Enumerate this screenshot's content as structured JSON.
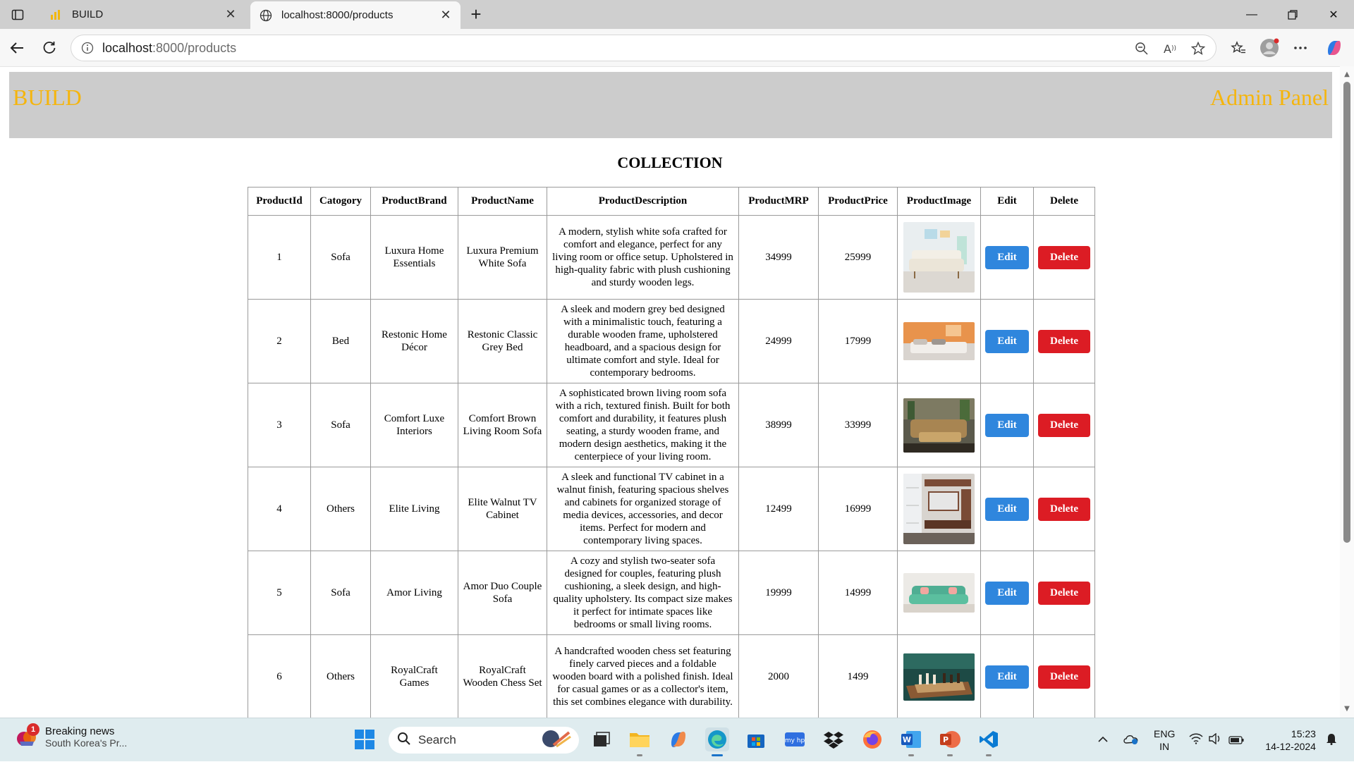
{
  "browser": {
    "tabs": [
      {
        "title": "BUILD",
        "active": false
      },
      {
        "title": "localhost:8000/products",
        "active": true
      }
    ],
    "url_host": "localhost",
    "url_path": ":8000/products"
  },
  "site": {
    "brand": "BUILD",
    "admin_label": "Admin Panel"
  },
  "page": {
    "title": "COLLECTION"
  },
  "table": {
    "headers": [
      "ProductId",
      "Catogory",
      "ProductBrand",
      "ProductName",
      "ProductDescription",
      "ProductMRP",
      "ProductPrice",
      "ProductImage",
      "Edit",
      "Delete"
    ],
    "rows": [
      {
        "id": "1",
        "category": "Sofa",
        "brand": "Luxura Home Essentials",
        "name": "Luxura Premium White Sofa",
        "description": "A modern, stylish white sofa crafted for comfort and elegance, perfect for any living room or office setup. Upholstered in high-quality fabric with plush cushioning and sturdy wooden legs.",
        "mrp": "34999",
        "price": "25999",
        "image": "white-sofa-image",
        "edit": "Edit",
        "delete": "Delete"
      },
      {
        "id": "2",
        "category": "Bed",
        "brand": "Restonic Home Décor",
        "name": "Restonic Classic Grey Bed",
        "description": "A sleek and modern grey bed designed with a minimalistic touch, featuring a durable wooden frame, upholstered headboard, and a spacious design for ultimate comfort and style. Ideal for contemporary bedrooms.",
        "mrp": "24999",
        "price": "17999",
        "image": "grey-bed-image",
        "edit": "Edit",
        "delete": "Delete"
      },
      {
        "id": "3",
        "category": "Sofa",
        "brand": "Comfort Luxe Interiors",
        "name": "Comfort Brown Living Room Sofa",
        "description": "A sophisticated brown living room sofa with a rich, textured finish. Built for both comfort and durability, it features plush seating, a sturdy wooden frame, and modern design aesthetics, making it the centerpiece of your living room.",
        "mrp": "38999",
        "price": "33999",
        "image": "brown-sofa-image",
        "edit": "Edit",
        "delete": "Delete"
      },
      {
        "id": "4",
        "category": "Others",
        "brand": "Elite Living",
        "name": "Elite Walnut TV Cabinet",
        "description": "A sleek and functional TV cabinet in a walnut finish, featuring spacious shelves and cabinets for organized storage of media devices, accessories, and decor items. Perfect for modern and contemporary living spaces.",
        "mrp": "12499",
        "price": "16999",
        "image": "tv-cabinet-image",
        "edit": "Edit",
        "delete": "Delete"
      },
      {
        "id": "5",
        "category": "Sofa",
        "brand": "Amor Living",
        "name": "Amor Duo Couple Sofa",
        "description": "A cozy and stylish two-seater sofa designed for couples, featuring plush cushioning, a sleek design, and high-quality upholstery. Its compact size makes it perfect for intimate spaces like bedrooms or small living rooms.",
        "mrp": "19999",
        "price": "14999",
        "image": "teal-sofa-image",
        "edit": "Edit",
        "delete": "Delete"
      },
      {
        "id": "6",
        "category": "Others",
        "brand": "RoyalCraft Games",
        "name": "RoyalCraft Wooden Chess Set",
        "description": "A handcrafted wooden chess set featuring finely carved pieces and a foldable wooden board with a polished finish. Ideal for casual games or as a collector's item, this set combines elegance with durability.",
        "mrp": "2000",
        "price": "1499",
        "image": "chess-set-image",
        "edit": "Edit",
        "delete": "Delete"
      }
    ]
  },
  "taskbar": {
    "news_badge": "1",
    "news_title": "Breaking news",
    "news_subtitle": "South Korea's Pr...",
    "search_label": "Search",
    "lang_line1": "ENG",
    "lang_line2": "IN",
    "time": "15:23",
    "date": "14-12-2024"
  },
  "colors": {
    "brand_text": "#f5b50d",
    "header_bg": "#cccccc",
    "edit_button": "#2f86dd",
    "delete_button": "#dc1c24"
  }
}
